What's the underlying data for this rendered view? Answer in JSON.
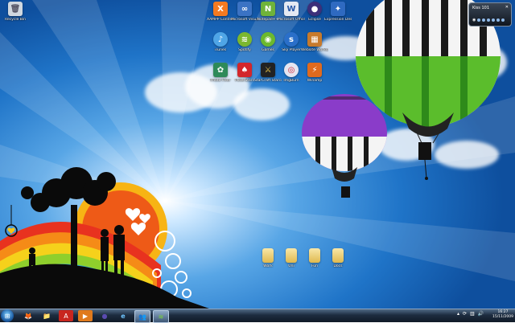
{
  "desktop_icons": [
    {
      "label": "Recycle Bin",
      "icon": "recycle-bin-icon",
      "color": "#d0d8e0",
      "glyph": "🗑"
    },
    {
      "label": "XAMPP Control Panel",
      "icon": "xampp-icon",
      "color": "#f47a20",
      "glyph": "X"
    },
    {
      "label": "Microsoft Visual Web...",
      "icon": "visual-web-icon",
      "color": "#3b73c4",
      "glyph": "∞"
    },
    {
      "label": "Notepad++",
      "icon": "notepad-plus-icon",
      "color": "#6fb33a",
      "glyph": "N"
    },
    {
      "label": "Microsoft Office Up...",
      "icon": "office-icon",
      "color": "#e4e9f2",
      "glyph": "W"
    },
    {
      "label": "Eclipse",
      "icon": "eclipse-icon",
      "color": "#3c2f7a",
      "glyph": "●"
    },
    {
      "label": "Expression Design Pro",
      "icon": "expression-design-icon",
      "color": "#2f6ac1",
      "glyph": "✦"
    },
    {
      "label": "iTunes",
      "icon": "itunes-icon",
      "color": "#4fa5e6",
      "glyph": "♪"
    },
    {
      "label": "Spotify",
      "icon": "spotify-icon",
      "color": "#7bb72f",
      "glyph": "≋"
    },
    {
      "label": "Games",
      "icon": "games-icon",
      "color": "#6cb92d",
      "glyph": "◉"
    },
    {
      "label": "Sky Player",
      "icon": "sky-player-icon",
      "color": "#2a6fc9",
      "glyph": "s"
    },
    {
      "label": "Website Workstation",
      "icon": "website-workstation-icon",
      "color": "#c77a2c",
      "glyph": "▦"
    },
    {
      "label": "Photo Fixer",
      "icon": "photo-fixer-icon",
      "color": "#2e8a5a",
      "glyph": "✿"
    },
    {
      "label": "PokerStars",
      "icon": "pokerstars-icon",
      "color": "#d3262b",
      "glyph": "♠"
    },
    {
      "label": "StarCraft Starcraft Brood...",
      "icon": "starcraft-icon",
      "color": "#222222",
      "glyph": "⚔"
    },
    {
      "label": "ImgBurn",
      "icon": "imgburn-icon",
      "color": "#e5e5f0",
      "glyph": "◎"
    },
    {
      "label": "Winamp",
      "icon": "winamp-icon",
      "color": "#e06a1e",
      "glyph": "⚡"
    }
  ],
  "folders": [
    {
      "label": "Work",
      "icon": "folder-icon"
    },
    {
      "label": "Uni",
      "icon": "folder-icon"
    },
    {
      "label": "Fun",
      "icon": "folder-icon"
    },
    {
      "label": "Docs",
      "icon": "folder-icon"
    }
  ],
  "gadget": {
    "title": "Kiss 101",
    "close": "✕",
    "icon": "radio-gadget-icon"
  },
  "taskbar": {
    "start": "start-orb-icon",
    "items": [
      {
        "icon": "firefox-icon",
        "glyph": "🦊",
        "active": false
      },
      {
        "icon": "explorer-icon",
        "glyph": "📁",
        "active": false
      },
      {
        "icon": "acrobat-icon",
        "glyph": "A",
        "active": false
      },
      {
        "icon": "media-player-icon",
        "glyph": "▶",
        "active": false
      },
      {
        "icon": "eclipse-icon",
        "glyph": "●",
        "active": false
      },
      {
        "icon": "internet-explorer-icon",
        "glyph": "e",
        "active": false
      },
      {
        "icon": "messenger-icon",
        "glyph": "👥",
        "active": true
      },
      {
        "icon": "spotify-icon",
        "glyph": "≋",
        "active": true
      }
    ],
    "clock_time": "16:27",
    "clock_date": "15/11/2009"
  }
}
